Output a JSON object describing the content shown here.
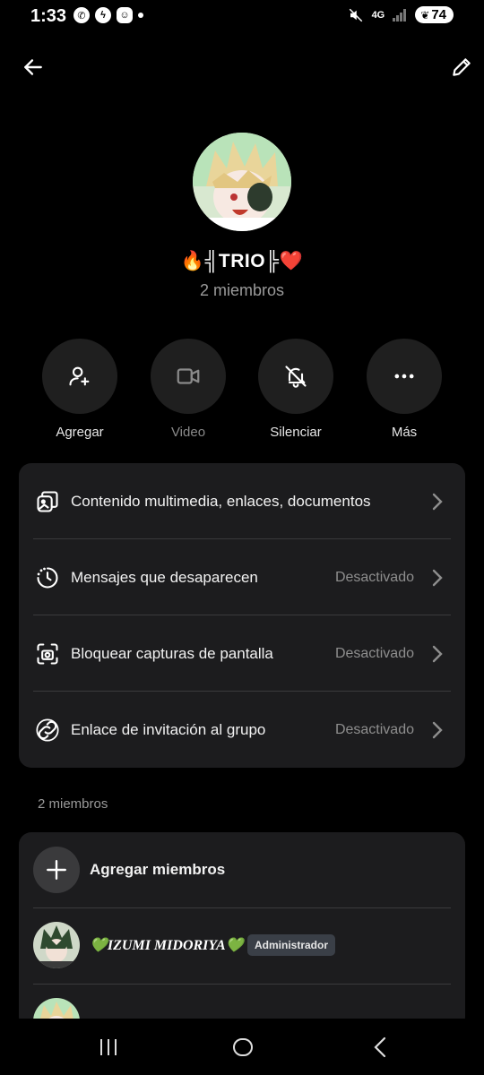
{
  "status": {
    "time": "1:33",
    "network": "4G",
    "battery": "74"
  },
  "group": {
    "name": "🔥╣TRIO╠❤️",
    "member_count": "2 miembros"
  },
  "actions": [
    {
      "label": "Agregar",
      "icon": "add-user-icon"
    },
    {
      "label": "Video",
      "icon": "video-icon"
    },
    {
      "label": "Silenciar",
      "icon": "bell-off-icon"
    },
    {
      "label": "Más",
      "icon": "more-icon"
    }
  ],
  "settings": [
    {
      "label": "Contenido multimedia, enlaces, documentos",
      "value": "",
      "icon": "media-icon"
    },
    {
      "label": "Mensajes que desaparecen",
      "value": "Desactivado",
      "icon": "timer-icon"
    },
    {
      "label": "Bloquear capturas de pantalla",
      "value": "Desactivado",
      "icon": "screenshot-icon"
    },
    {
      "label": "Enlace de invitación al grupo",
      "value": "Desactivado",
      "icon": "link-icon"
    }
  ],
  "members_section": {
    "label": "2 miembros",
    "add_label": "Agregar miembros",
    "members": [
      {
        "name": "💚IZUMI MIDORIYA💚",
        "badge": "Administrador"
      },
      {
        "name": "",
        "badge": ""
      }
    ]
  },
  "colors": {
    "background": "#000000",
    "card": "#1c1c1e",
    "button": "#1f1f1f",
    "muted_text": "#8e8e8e"
  }
}
